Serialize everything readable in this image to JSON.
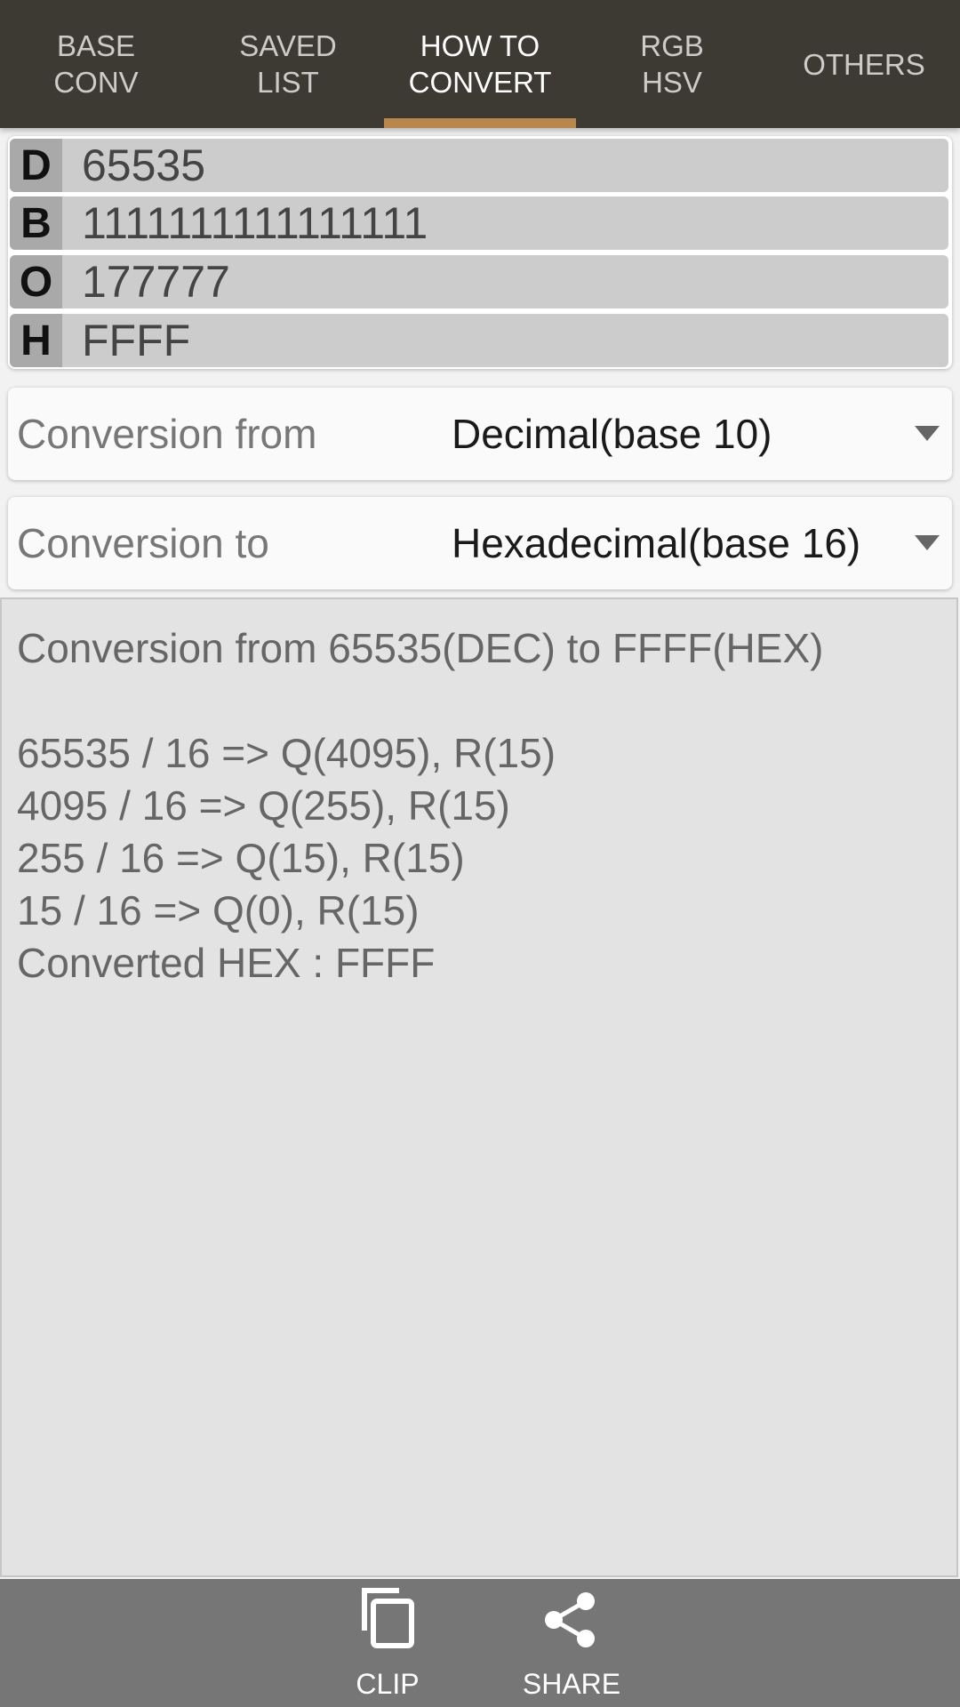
{
  "tabs": [
    {
      "line1": "BASE",
      "line2": "CONV",
      "active": false
    },
    {
      "line1": "SAVED",
      "line2": "LIST",
      "active": false
    },
    {
      "line1": "HOW TO",
      "line2": "CONVERT",
      "active": true
    },
    {
      "line1": "RGB",
      "line2": "HSV",
      "active": false
    },
    {
      "line1": "OTHERS",
      "line2": "",
      "active": false
    }
  ],
  "values": [
    {
      "tag": "D",
      "value": "65535"
    },
    {
      "tag": "B",
      "value": "1111111111111111"
    },
    {
      "tag": "O",
      "value": "177777"
    },
    {
      "tag": "H",
      "value": "FFFF"
    }
  ],
  "conversion_from": {
    "label": "Conversion from",
    "selected": "Decimal(base 10)"
  },
  "conversion_to": {
    "label": "Conversion to",
    "selected": "Hexadecimal(base 16)"
  },
  "explanation": {
    "title": "Conversion from 65535(DEC) to FFFF(HEX)",
    "steps": [
      "65535 / 16 => Q(4095), R(15)",
      "4095 / 16 => Q(255), R(15)",
      "255 / 16 => Q(15), R(15)",
      "15 / 16 => Q(0), R(15)"
    ],
    "result": "Converted HEX : FFFF"
  },
  "bottom_actions": {
    "clip": {
      "label": "CLIP",
      "icon": "copy-icon"
    },
    "share": {
      "label": "SHARE",
      "icon": "share-icon"
    }
  },
  "colors": {
    "tabbar_bg": "#3d3a34",
    "tab_indicator": "#b8874e",
    "bottom_bar_bg": "#767676"
  }
}
